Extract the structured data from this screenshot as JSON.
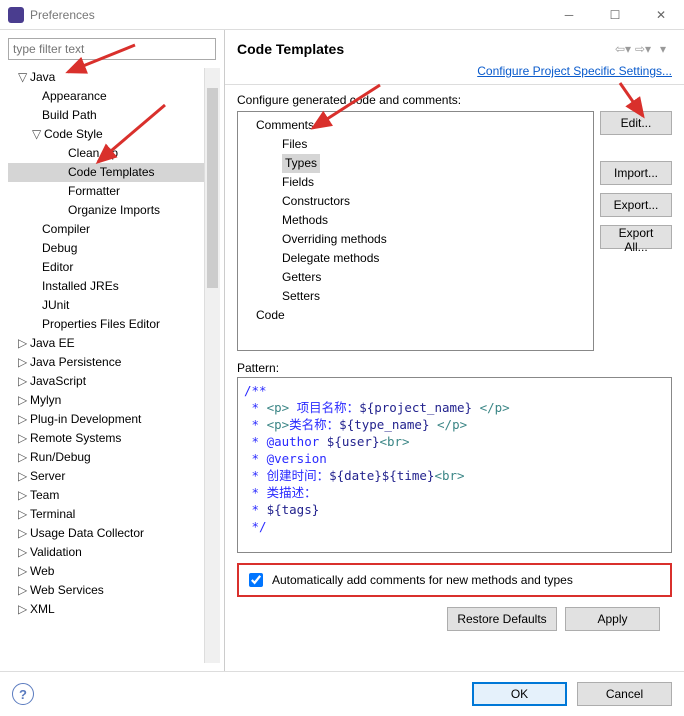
{
  "window": {
    "title": "Preferences"
  },
  "filter_placeholder": "type filter text",
  "left_tree": [
    {
      "label": "Java",
      "level": 0,
      "exp": "▽"
    },
    {
      "label": "Appearance",
      "level": 1
    },
    {
      "label": "Build Path",
      "level": 1
    },
    {
      "label": "Code Style",
      "level": 1,
      "exp": "▽"
    },
    {
      "label": "Clean Up",
      "level": 2
    },
    {
      "label": "Code Templates",
      "level": 2,
      "selected": true
    },
    {
      "label": "Formatter",
      "level": 2
    },
    {
      "label": "Organize Imports",
      "level": 2
    },
    {
      "label": "Compiler",
      "level": 1
    },
    {
      "label": "Debug",
      "level": 1
    },
    {
      "label": "Editor",
      "level": 1
    },
    {
      "label": "Installed JREs",
      "level": 1
    },
    {
      "label": "JUnit",
      "level": 1
    },
    {
      "label": "Properties Files Editor",
      "level": 1
    },
    {
      "label": "Java EE",
      "level": 0
    },
    {
      "label": "Java Persistence",
      "level": 0
    },
    {
      "label": "JavaScript",
      "level": 0
    },
    {
      "label": "Mylyn",
      "level": 0
    },
    {
      "label": "Plug-in Development",
      "level": 0
    },
    {
      "label": "Remote Systems",
      "level": 0
    },
    {
      "label": "Run/Debug",
      "level": 0
    },
    {
      "label": "Server",
      "level": 0
    },
    {
      "label": "Team",
      "level": 0
    },
    {
      "label": "Terminal",
      "level": 0
    },
    {
      "label": "Usage Data Collector",
      "level": 0
    },
    {
      "label": "Validation",
      "level": 0
    },
    {
      "label": "Web",
      "level": 0
    },
    {
      "label": "Web Services",
      "level": 0
    },
    {
      "label": "XML",
      "level": 0
    }
  ],
  "right": {
    "heading": "Code Templates",
    "link": "Configure Project Specific Settings...",
    "desc": "Configure generated code and comments:",
    "comment_tree": [
      {
        "label": "Comments",
        "level": 0
      },
      {
        "label": "Files",
        "level": 1
      },
      {
        "label": "Types",
        "level": 1,
        "selected": true
      },
      {
        "label": "Fields",
        "level": 1
      },
      {
        "label": "Constructors",
        "level": 1
      },
      {
        "label": "Methods",
        "level": 1
      },
      {
        "label": "Overriding methods",
        "level": 1
      },
      {
        "label": "Delegate methods",
        "level": 1
      },
      {
        "label": "Getters",
        "level": 1
      },
      {
        "label": "Setters",
        "level": 1
      },
      {
        "label": "Code",
        "level": 0
      }
    ],
    "buttons": {
      "edit": "Edit...",
      "import": "Import...",
      "export": "Export...",
      "export_all": "Export All..."
    },
    "pattern_label": "Pattern:",
    "pattern_lines": [
      {
        "segments": [
          {
            "t": "/**",
            "c": "blue"
          }
        ]
      },
      {
        "segments": [
          {
            "t": " * ",
            "c": "blue"
          },
          {
            "t": "<p>",
            "c": "teal"
          },
          {
            "t": " 项目名称：",
            "c": "blue"
          },
          {
            "t": "${project_name}",
            "c": "navy"
          },
          {
            "t": " ",
            "c": "blue"
          },
          {
            "t": "</p>",
            "c": "teal"
          }
        ]
      },
      {
        "segments": [
          {
            "t": " * ",
            "c": "blue"
          },
          {
            "t": "<p>",
            "c": "teal"
          },
          {
            "t": "类名称：",
            "c": "blue"
          },
          {
            "t": "${type_name}",
            "c": "navy"
          },
          {
            "t": " ",
            "c": "blue"
          },
          {
            "t": "</p>",
            "c": "teal"
          }
        ]
      },
      {
        "segments": [
          {
            "t": " * @author ",
            "c": "blue"
          },
          {
            "t": "${user}",
            "c": "navy"
          },
          {
            "t": "<br>",
            "c": "teal"
          }
        ]
      },
      {
        "segments": [
          {
            "t": " * @version",
            "c": "blue"
          }
        ]
      },
      {
        "segments": [
          {
            "t": " * 创建时间：",
            "c": "blue"
          },
          {
            "t": "${date}${time}",
            "c": "navy"
          },
          {
            "t": "<br>",
            "c": "teal"
          }
        ]
      },
      {
        "segments": [
          {
            "t": " * 类描述：",
            "c": "blue"
          }
        ]
      },
      {
        "segments": [
          {
            "t": " * ",
            "c": "blue"
          },
          {
            "t": "${tags}",
            "c": "navy"
          }
        ]
      },
      {
        "segments": [
          {
            "t": " */",
            "c": "blue"
          }
        ]
      }
    ],
    "auto_checkbox": "Automatically add comments for new methods and types",
    "restore": "Restore Defaults",
    "apply": "Apply"
  },
  "footer": {
    "ok": "OK",
    "cancel": "Cancel"
  }
}
